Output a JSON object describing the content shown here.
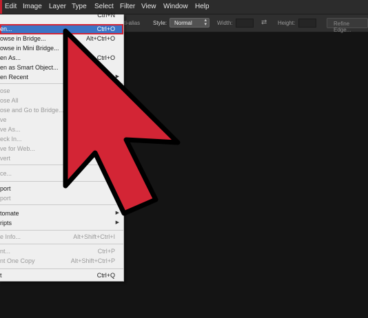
{
  "menubar": {
    "items": [
      "Edit",
      "Image",
      "Layer",
      "Type",
      "Select",
      "Filter",
      "View",
      "Window",
      "Help"
    ]
  },
  "options": {
    "antialias_text": "ti-alias",
    "style_label": "Style:",
    "style_value": "Normal",
    "width_label": "Width:",
    "height_label": "Height:",
    "refine_label": "Refine Edge..."
  },
  "file_menu": {
    "top_shortcut": "Ctrl+N",
    "items": [
      {
        "label": "en...",
        "shortcut": "Ctrl+O"
      },
      {
        "label": "owse in Bridge...",
        "shortcut": "Alt+Ctrl+O"
      },
      {
        "label": "owse in Mini Bridge..."
      },
      {
        "label": "en As...",
        "shortcut": "Ctrl+O"
      },
      {
        "label": "en as Smart Object..."
      },
      {
        "label": "en Recent"
      },
      {
        "label": "ose"
      },
      {
        "label": "ose All"
      },
      {
        "label": "ose and Go to Bridge..."
      },
      {
        "label": "ve"
      },
      {
        "label": "ve As..."
      },
      {
        "label": "eck In..."
      },
      {
        "label": "ve for Web..."
      },
      {
        "label": "vert"
      },
      {
        "label": "ce..."
      },
      {
        "label": "port"
      },
      {
        "label": "port"
      },
      {
        "label": "tomate"
      },
      {
        "label": "ripts"
      },
      {
        "label": "e Info...",
        "shortcut": "Alt+Shift+Ctrl+I"
      },
      {
        "label": "nt...",
        "shortcut": "Ctrl+P"
      },
      {
        "label": "nt One Copy",
        "shortcut": "Alt+Shift+Ctrl+P"
      },
      {
        "label": "t",
        "shortcut": "Ctrl+Q"
      }
    ]
  },
  "colors": {
    "highlight": "#3b74c6",
    "callout_red": "#d32535"
  }
}
